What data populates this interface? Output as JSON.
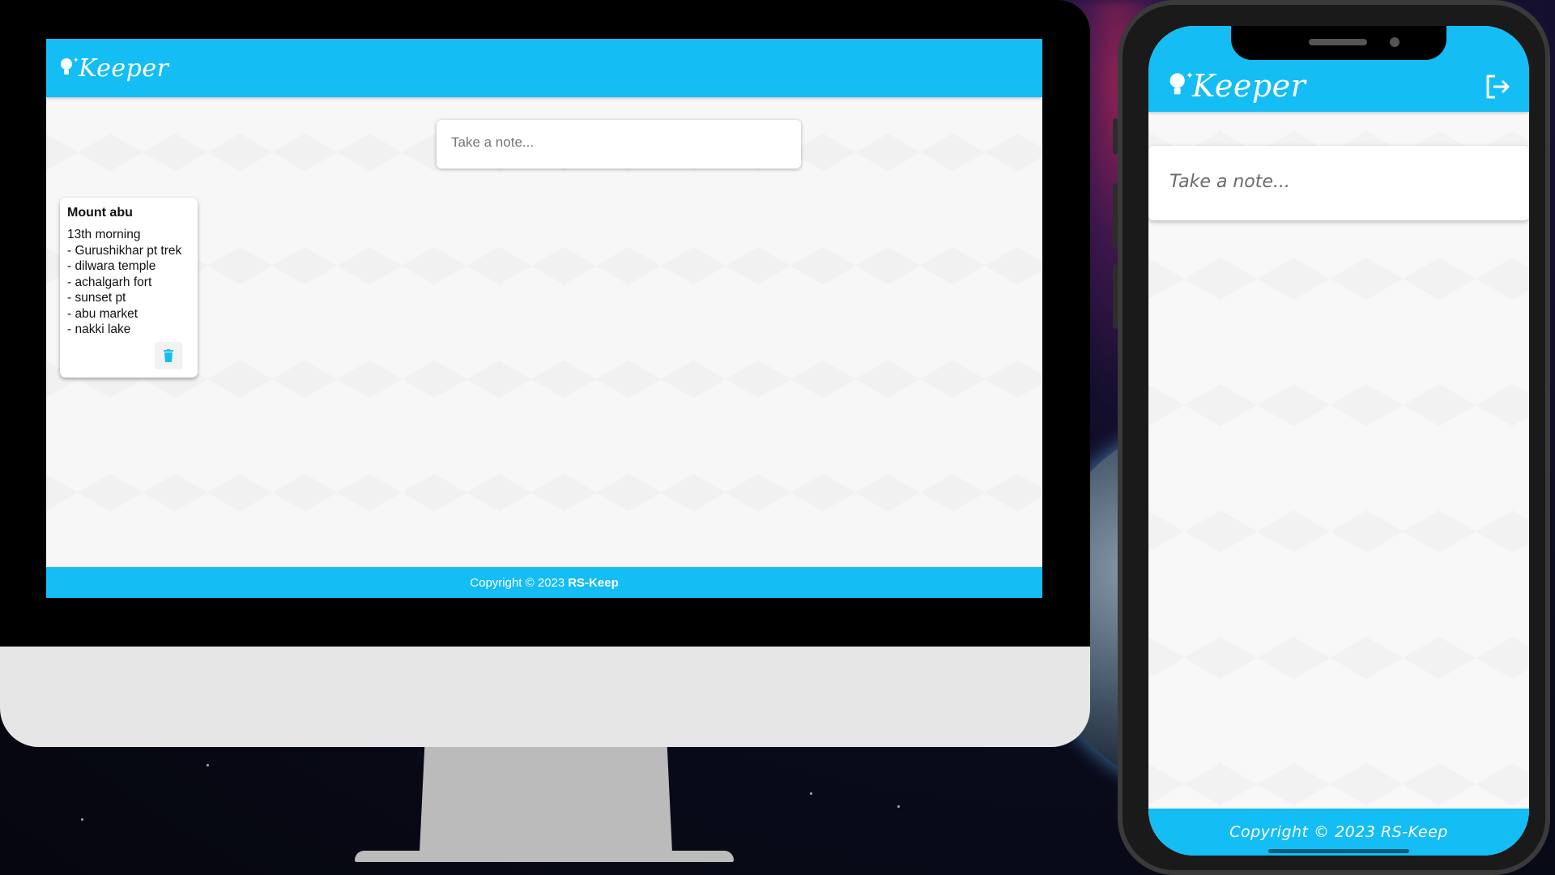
{
  "desktop": {
    "app_title": "Keeper",
    "note_input": {
      "placeholder": "Take a note..."
    },
    "notes": [
      {
        "title": "Mount abu",
        "lines": [
          "13th morning",
          "- Gurushikhar pt trek",
          "- dilwara temple",
          "- achalgarh fort",
          "- sunset pt",
          "- abu market",
          "- nakki lake"
        ],
        "delete_icon": "trash-icon"
      }
    ],
    "footer": {
      "text": "Copyright © 2023",
      "brand": "RS-Keep"
    }
  },
  "mobile": {
    "app_title": "Keeper",
    "logout_icon": "logout-icon",
    "note_input": {
      "placeholder": "Take a note..."
    },
    "footer": {
      "text": "Copyright © 2023 RS-Keep"
    }
  },
  "colors": {
    "accent": "#14bdf3",
    "page_background": "#f7f7f7",
    "note_background": "#ffffff"
  }
}
